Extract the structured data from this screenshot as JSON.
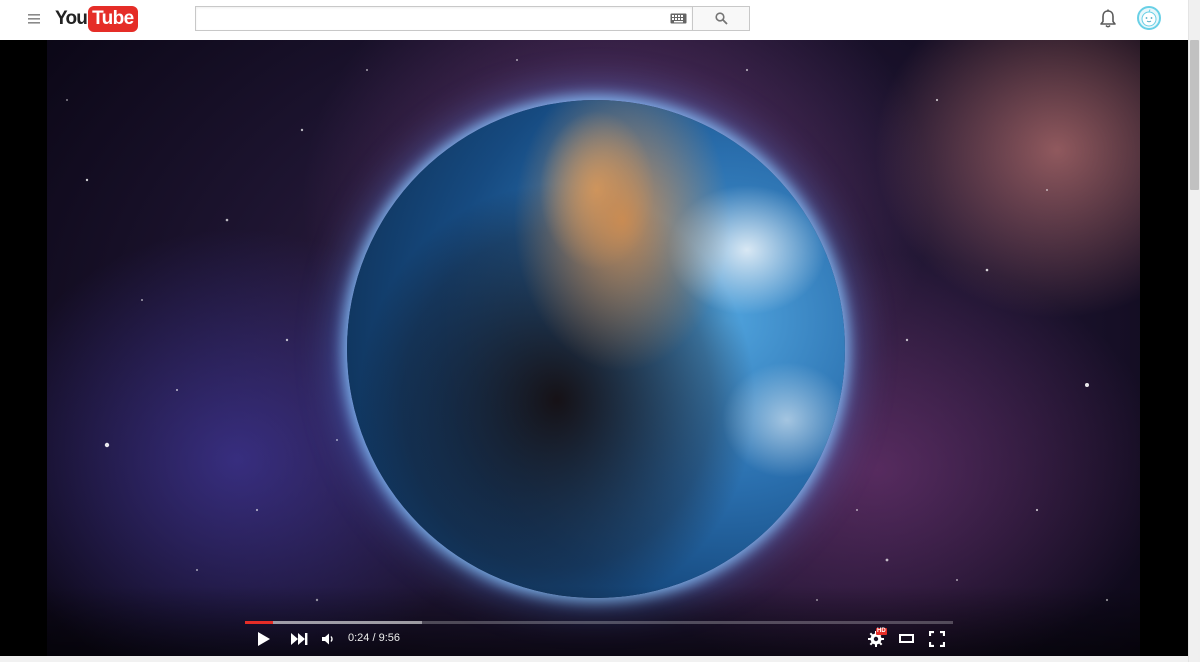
{
  "masthead": {
    "logo_you": "You",
    "logo_tube": "Tube",
    "search": {
      "value": "",
      "placeholder": ""
    },
    "icons": {
      "guide": "hamburger-menu-icon",
      "keyboard": "keyboard-icon",
      "search": "search-icon",
      "notifications": "bell-icon",
      "account": "avatar"
    }
  },
  "player": {
    "current_time": "0:24",
    "separator": " / ",
    "duration": "9:56",
    "played_fraction": 0.04,
    "loaded_fraction": 0.25,
    "hd_badge": "HD",
    "accent_color": "#e52d27"
  }
}
